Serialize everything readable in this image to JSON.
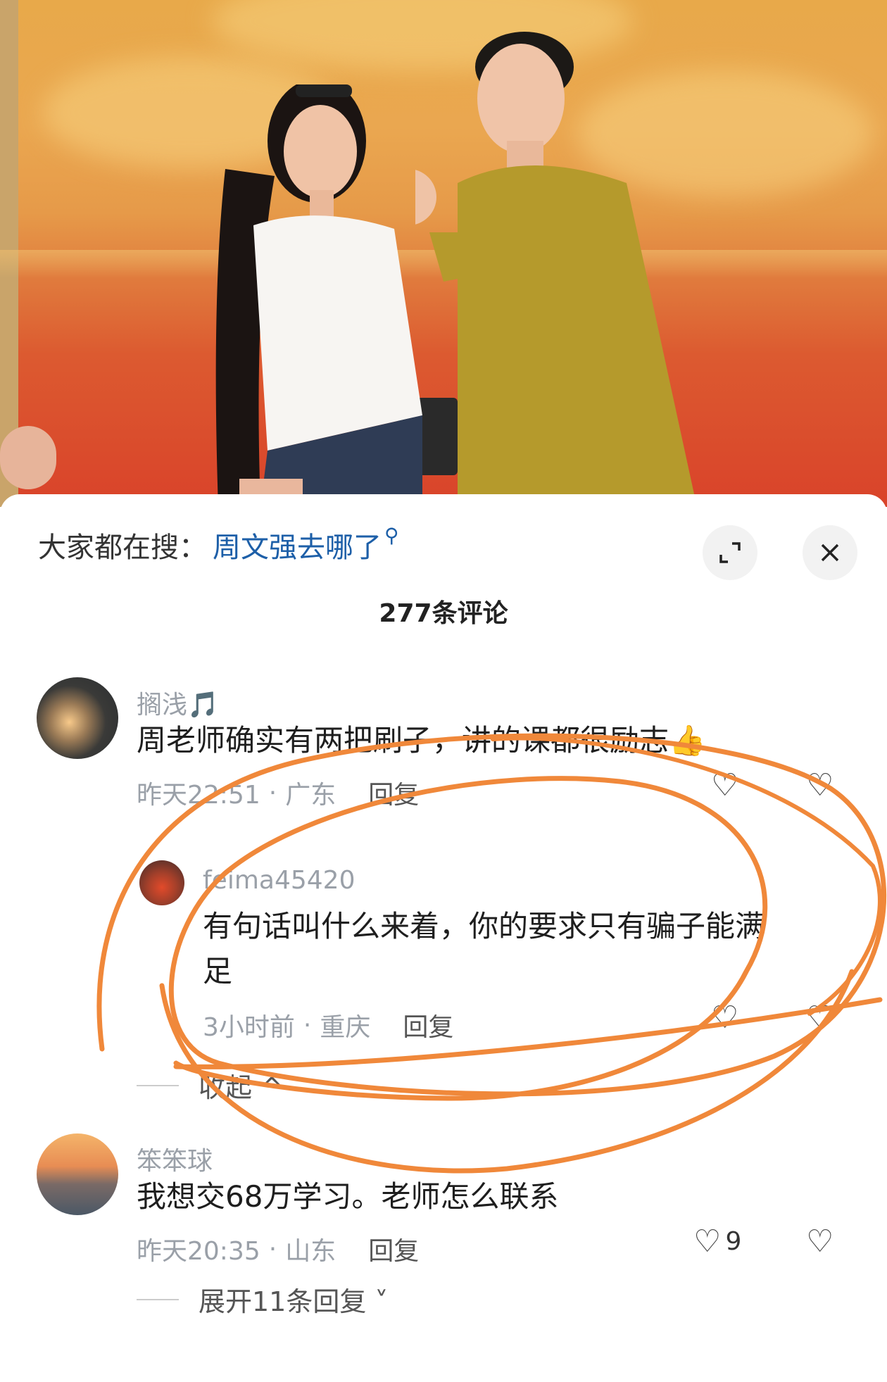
{
  "search": {
    "label": "大家都在搜：",
    "term": "周文强去哪了",
    "search_icon": "search-icon"
  },
  "controls": {
    "expand_icon": "expand-icon",
    "close_icon": "close-icon"
  },
  "comment_count": "277条评论",
  "comments": [
    {
      "username": "搁浅🎵",
      "text": "周老师确实有两把刷子，讲的课都很励志👍",
      "time": "昨天22:51",
      "location": "广东",
      "reply_label": "回复",
      "replies": [
        {
          "username": "feima45420",
          "text_line1": "有句话叫什么来着，你的要求只有骗子能满",
          "text_line2": "足",
          "time": "3小时前",
          "location": "重庆",
          "reply_label": "回复"
        }
      ],
      "collapse_label": "收起 ^"
    },
    {
      "username": "笨笨球",
      "text": "我想交68万学习。老师怎么联系",
      "time": "昨天20:35",
      "location": "山东",
      "reply_label": "回复",
      "likes": "9",
      "expand_label": "展开11条回复 ˅"
    }
  ],
  "colors": {
    "accent_blue": "#1d5fa8",
    "annotation_orange": "#f0883a",
    "muted_text": "#9aa0a8"
  }
}
